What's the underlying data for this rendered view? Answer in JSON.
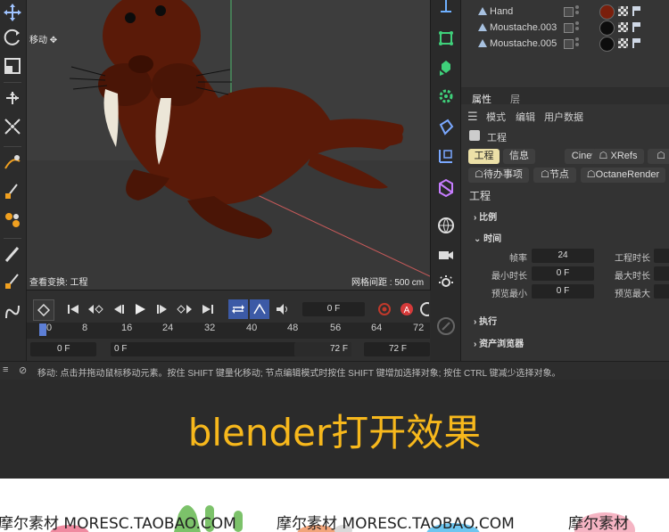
{
  "viewport": {
    "tool_label": "移动",
    "view_transform_label": "查看变换: 工程",
    "grid_spacing_label": "网格间距 : 500 cm"
  },
  "object_manager": {
    "objects": [
      {
        "label": "Hand"
      },
      {
        "label": "Moustache.003"
      },
      {
        "label": "Moustache.005"
      }
    ]
  },
  "attributes": {
    "tabs": [
      "属性",
      "层"
    ],
    "menu": [
      "模式",
      "编辑",
      "用户数据"
    ],
    "context_title": "工程",
    "pills_row1": [
      "工程",
      "信息",
      "Cineware",
      "XRefs"
    ],
    "pills_row2": [
      "待办事项",
      "节点",
      "OctaneRender"
    ],
    "section_title": "工程",
    "sections": {
      "scale": "比例",
      "time": "时间",
      "execute": "执行",
      "asset_browser": "资产浏览器"
    },
    "fields": {
      "fps_label": "帧率",
      "fps_value": "24",
      "project_length_label": "工程时长",
      "min_time_label": "最小时长",
      "min_time_value": "0 F",
      "max_time_label": "最大时长",
      "preview_min_label": "预览最小",
      "preview_min_value": "0 F",
      "preview_max_label": "预览最大"
    }
  },
  "timeline": {
    "current_frame": "0 F",
    "ticks": [
      "0",
      "8",
      "16",
      "24",
      "32",
      "40",
      "48",
      "56",
      "64",
      "72"
    ],
    "start_frame": "0 F",
    "preview_start": "0 F",
    "preview_end": "72 F",
    "end_frame": "72 F"
  },
  "status_bar": {
    "message": "移动: 点击并拖动鼠标移动元素。按住 SHIFT 键量化移动; 节点编辑模式时按住 SHIFT 键增加选择对象; 按住 CTRL 键减少选择对象。"
  },
  "caption": {
    "text": "blender打开效果"
  },
  "watermarks": [
    "摩尔素材 MORESC.TAOBAO.COM",
    "摩尔素材 MORESC.TAOBAO.COM",
    "摩尔素材"
  ],
  "colors": {
    "accent_yellow": "#f7b81c",
    "active_pill": "#ece0a7",
    "walrus_body": "#5a1a08",
    "tusk": "#ece6d8"
  }
}
